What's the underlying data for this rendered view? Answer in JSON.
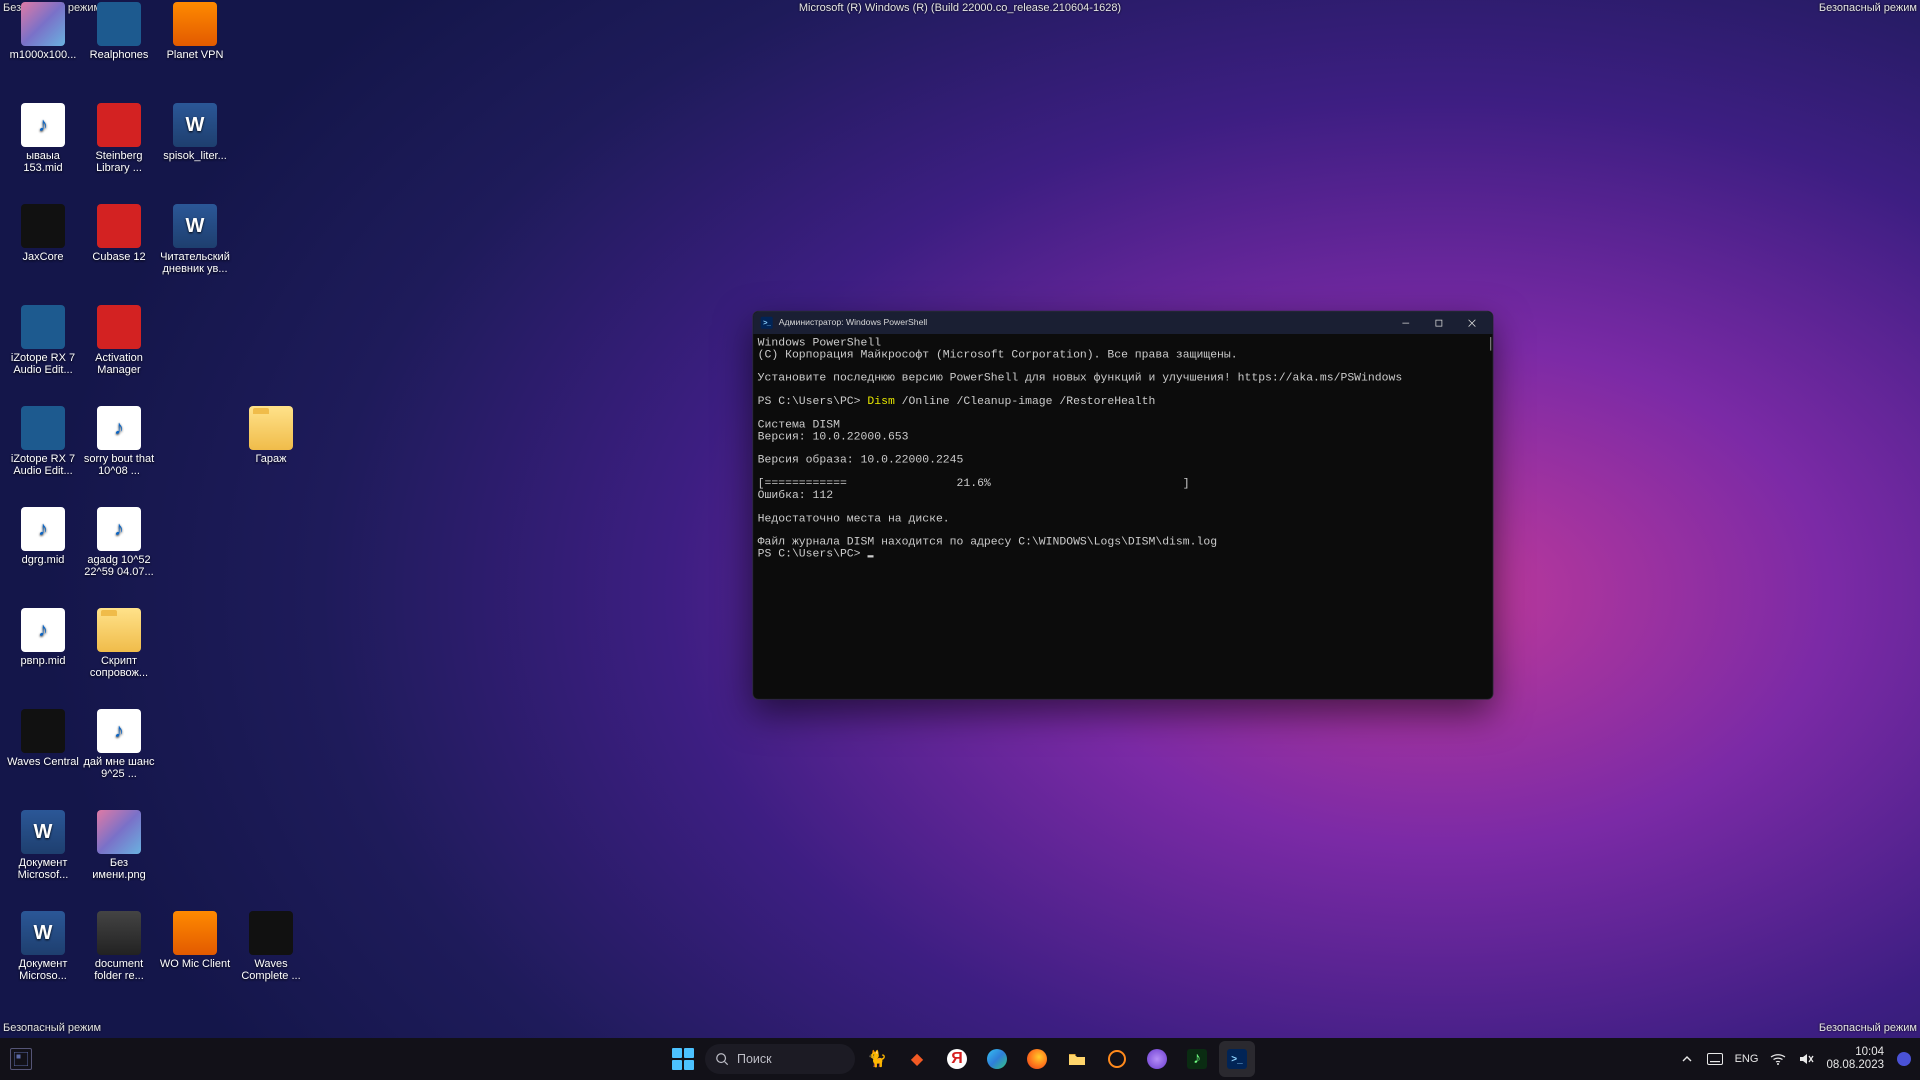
{
  "watermark": {
    "top_left": "Безопасный режим",
    "top_center": "Microsoft (R) Windows (R) (Build 22000.co_release.210604-1628)",
    "top_right": "Безопасный режим",
    "bottom_left": "Безопасный режим",
    "bottom_right": "Безопасный режим"
  },
  "desktop": {
    "icons": [
      {
        "label": "m1000x100...",
        "kind": "photo",
        "col": 0,
        "row": 0
      },
      {
        "label": "Realphones",
        "kind": "steel",
        "col": 1,
        "row": 0
      },
      {
        "label": "Planet VPN",
        "kind": "orange",
        "col": 2,
        "row": 0
      },
      {
        "label": "ываыа 153.mid",
        "kind": "midi",
        "col": 0,
        "row": 1
      },
      {
        "label": "Steinberg Library ...",
        "kind": "red",
        "col": 1,
        "row": 1
      },
      {
        "label": "spisok_liter...",
        "kind": "word",
        "col": 2,
        "row": 1
      },
      {
        "label": "JaxCore",
        "kind": "black",
        "col": 0,
        "row": 2
      },
      {
        "label": "Cubase 12",
        "kind": "red",
        "col": 1,
        "row": 2
      },
      {
        "label": "Читательский дневник ув...",
        "kind": "word",
        "col": 2,
        "row": 2
      },
      {
        "label": "iZotope RX 7 Audio Edit...",
        "kind": "steel",
        "col": 0,
        "row": 3
      },
      {
        "label": "Activation Manager",
        "kind": "red",
        "col": 1,
        "row": 3
      },
      {
        "label": "iZotope RX 7 Audio Edit...",
        "kind": "steel",
        "col": 0,
        "row": 4
      },
      {
        "label": "sorry bout that 10^08 ...",
        "kind": "midi",
        "col": 1,
        "row": 4
      },
      {
        "label": "Гараж",
        "kind": "folder",
        "col": 3,
        "row": 4
      },
      {
        "label": "dgrg.mid",
        "kind": "midi",
        "col": 0,
        "row": 5
      },
      {
        "label": "agadg 10^52 22^59 04.07...",
        "kind": "midi",
        "col": 1,
        "row": 5
      },
      {
        "label": "pвnp.mid",
        "kind": "midi",
        "col": 0,
        "row": 6
      },
      {
        "label": "Скрипт сопровож...",
        "kind": "folder",
        "col": 1,
        "row": 6
      },
      {
        "label": "Waves Central",
        "kind": "black",
        "col": 0,
        "row": 7
      },
      {
        "label": "дай мне шанс 9^25 ...",
        "kind": "midi",
        "col": 1,
        "row": 7
      },
      {
        "label": "Документ Microsof...",
        "kind": "word",
        "col": 0,
        "row": 8
      },
      {
        "label": "Без имени.png",
        "kind": "photo",
        "col": 1,
        "row": 8
      },
      {
        "label": "Документ Microso...",
        "kind": "word",
        "col": 0,
        "row": 9
      },
      {
        "label": "document folder re...",
        "kind": "app",
        "col": 1,
        "row": 9
      },
      {
        "label": "WO Mic Client",
        "kind": "orange",
        "col": 2,
        "row": 9
      },
      {
        "label": "Waves Complete ...",
        "kind": "black",
        "col": 3,
        "row": 9
      }
    ]
  },
  "window": {
    "title": "Администратор: Windows PowerShell",
    "term": {
      "l1": "Windows PowerShell",
      "l2": "(C) Корпорация Майкрософт (Microsoft Corporation). Все права защищены.",
      "l3": "Установите последнюю версию PowerShell для новых функций и улучшения! https://aka.ms/PSWindows",
      "prompt1": "PS C:\\Users\\PC> ",
      "cmd_exe": "Dism",
      "cmd_args": " /Online /Cleanup-image /RestoreHealth",
      "l6": "Система DISM",
      "l7": "Версия: 10.0.22000.653",
      "l8": "Версия образа: 10.0.22000.2245",
      "l9": "[============                21.6%                            ]",
      "l10": "Ошибка: 112",
      "l11": "Недостаточно места на диске.",
      "l12": "Файл журнала DISM находится по адресу C:\\WINDOWS\\Logs\\DISM\\dism.log",
      "prompt2": "PS C:\\Users\\PC> "
    }
  },
  "taskbar": {
    "search_placeholder": "Поиск",
    "lang": "ENG",
    "time": "10:04",
    "date": "08.08.2023"
  }
}
